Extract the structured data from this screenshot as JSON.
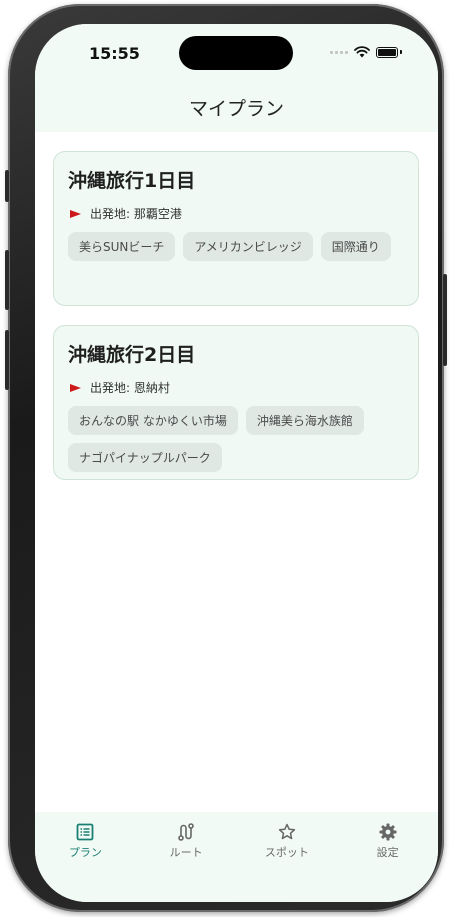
{
  "status_bar": {
    "time": "15:55"
  },
  "header": {
    "title": "マイプラン"
  },
  "plans": [
    {
      "title": "沖縄旅行1日目",
      "origin": "出発地: 那覇空港",
      "spots": [
        "美らSUNビーチ",
        "アメリカンビレッジ",
        "国際通り"
      ]
    },
    {
      "title": "沖縄旅行2日目",
      "origin": "出発地: 恩納村",
      "spots": [
        "おんなの駅 なかゆくい市場",
        "沖縄美ら海水族館",
        "ナゴパイナップルパーク"
      ]
    }
  ],
  "tabs": [
    {
      "label": "プラン",
      "icon": "list-icon",
      "active": true
    },
    {
      "label": "ルート",
      "icon": "route-icon",
      "active": false
    },
    {
      "label": "スポット",
      "icon": "star-icon",
      "active": false
    },
    {
      "label": "設定",
      "icon": "gear-icon",
      "active": false
    }
  ],
  "colors": {
    "accent": "#1a7f73",
    "header_bg": "#f1faf4",
    "card_bg": "#f0f9f3",
    "flag": "#cc1a1a"
  }
}
